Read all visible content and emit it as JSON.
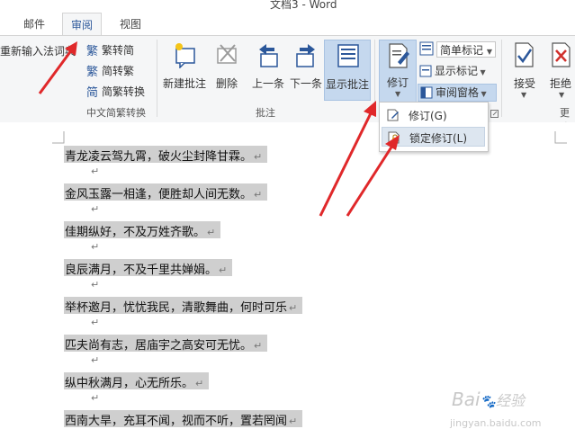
{
  "window": {
    "title": "文档3 - Word"
  },
  "tabs": [
    {
      "label": "邮件"
    },
    {
      "label": "审阅"
    },
    {
      "label": "视图"
    }
  ],
  "ribbon": {
    "ime_label": "重新输入法词典",
    "chinese_conv": {
      "to_simplified": "繁转简",
      "to_traditional": "简转繁",
      "conversion": "简繁转换",
      "group_label": "中文简繁转换"
    },
    "comments": {
      "new_comment": "新建批注",
      "delete": "删除",
      "previous": "上一条",
      "next": "下一条",
      "show_comments": "显示批注",
      "group_label": "批注"
    },
    "tracking": {
      "track_changes": "修订",
      "markup_dropdown": "简单标记",
      "show_markup": "显示标记",
      "reviewing_pane": "审阅窗格"
    },
    "changes": {
      "accept": "接受",
      "reject": "拒绝",
      "group_label_partial": "更改"
    }
  },
  "track_menu": {
    "items": [
      {
        "label": "修订(G)"
      },
      {
        "label": "锁定修订(L)"
      }
    ]
  },
  "document": {
    "lines": [
      "青龙凌云驾九霄，破火尘封降甘霖。",
      "金风玉露一相逢，便胜却人间无数。",
      "佳期纵好，不及万姓齐歌。",
      "良辰满月，不及千里共婵娟。",
      "举杯邀月，忧忧我民，清歌舞曲，何时可乐",
      "匹夫尚有志，居庙宇之高安可无忧。",
      "纵中秋满月，心无所乐。",
      "西南大旱，充耳不闻，视而不听，置若罔闻"
    ],
    "para_mark": "↵"
  },
  "watermark": {
    "brand": "Bai",
    "brand_tail": "经验",
    "url": "jingyan.baidu.com"
  },
  "colors": {
    "accent": "#2b579a",
    "arrow": "#e0282a",
    "selection": "#cfcfcf"
  }
}
